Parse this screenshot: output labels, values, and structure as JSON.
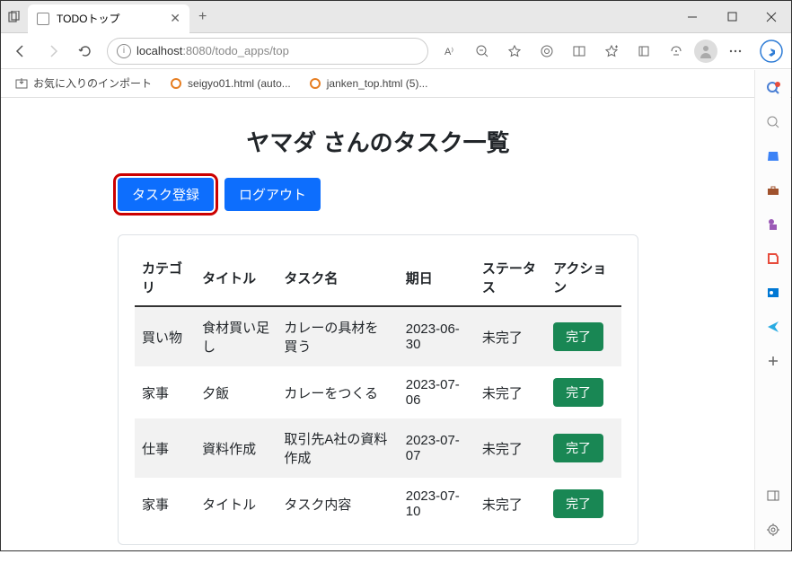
{
  "browser": {
    "tab_title": "TODOトップ",
    "url_host": "localhost",
    "url_port": ":8080",
    "url_path": "/todo_apps/top",
    "bookmarks": [
      {
        "label": "お気に入りのインポート",
        "icon": "import"
      },
      {
        "label": "seigyo01.html (auto...",
        "icon": "html"
      },
      {
        "label": "janken_top.html (5)...",
        "icon": "html"
      }
    ]
  },
  "page": {
    "title": "ヤマダ さんのタスク一覧",
    "register_btn": "タスク登録",
    "logout_btn": "ログアウト",
    "headers": {
      "category": "カテゴリ",
      "title": "タイトル",
      "task_name": "タスク名",
      "due": "期日",
      "status": "ステータス",
      "action": "アクション"
    },
    "rows": [
      {
        "category": "買い物",
        "title": "食材買い足し",
        "task": "カレーの具材を買う",
        "due": "2023-06-30",
        "status": "未完了",
        "action": "完了"
      },
      {
        "category": "家事",
        "title": "夕飯",
        "task": "カレーをつくる",
        "due": "2023-07-06",
        "status": "未完了",
        "action": "完了"
      },
      {
        "category": "仕事",
        "title": "資料作成",
        "task": "取引先A社の資料作成",
        "due": "2023-07-07",
        "status": "未完了",
        "action": "完了"
      },
      {
        "category": "家事",
        "title": "タイトル",
        "task": "タスク内容",
        "due": "2023-07-10",
        "status": "未完了",
        "action": "完了"
      }
    ]
  }
}
